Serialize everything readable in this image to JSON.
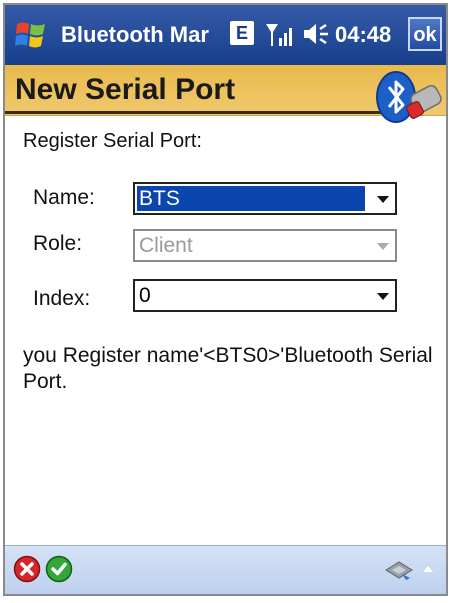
{
  "statusbar": {
    "app_title": "Bluetooth Mar",
    "network_badge": "E",
    "time": "04:48",
    "ok_label": "ok",
    "icons": [
      "windows-start-icon",
      "signal-icon",
      "speaker-icon"
    ]
  },
  "header": {
    "title": "New Serial Port",
    "icon": "bluetooth-icon"
  },
  "form": {
    "subtitle": "Register Serial Port:",
    "name_label": "Name:",
    "name_value": "BTS",
    "role_label": "Role:",
    "role_value": "Client",
    "index_label": "Index:",
    "index_value": "0"
  },
  "message": "you Register  name'<BTS0>'Bluetooth Serial Port.",
  "bottombar": {
    "icons": [
      "cancel-icon",
      "accept-icon",
      "keyboard-icon",
      "up-arrow-icon"
    ]
  },
  "colors": {
    "titlebar": "#1f4a9e",
    "header": "#efc262",
    "selection": "#0a46ad",
    "bottombar": "#c8d9f2"
  }
}
